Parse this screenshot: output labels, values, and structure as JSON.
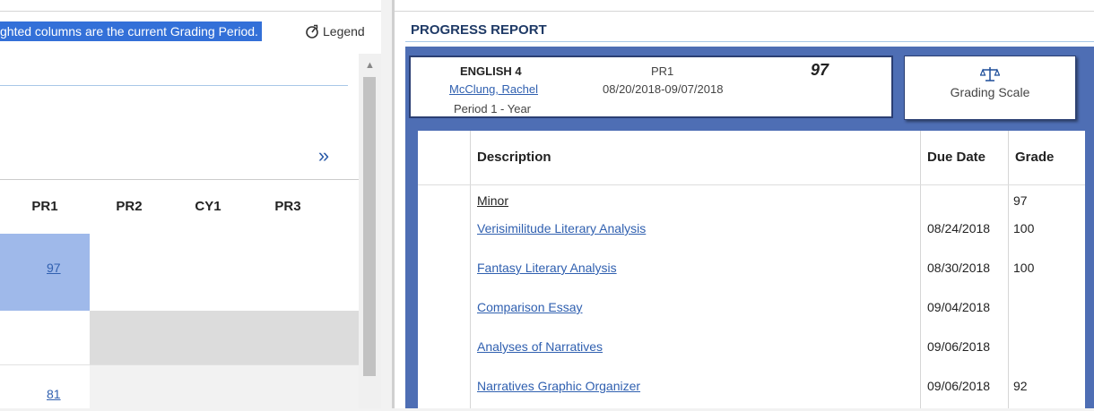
{
  "left": {
    "highlight_note": "ghted columns are the current Grading Period.",
    "legend_label": "Legend",
    "next_arrow": "»",
    "columns": [
      "PR1",
      "PR2",
      "CY1",
      "PR3"
    ],
    "rows": [
      {
        "PR1": "97"
      },
      {
        "PR1": ""
      },
      {
        "PR1": "81"
      }
    ],
    "scroll_up": "▲",
    "colors": {
      "highlight": "#3370d8",
      "current_period_cell": "#9fb9ea",
      "disabled_row": "#dcdcdc"
    }
  },
  "progress_report": {
    "title": "PROGRESS REPORT",
    "course": {
      "name": "ENGLISH 4",
      "teacher": "McClung, Rachel",
      "period": "Period 1 - Year",
      "term": "PR1",
      "date_range": "08/20/2018-09/07/2018",
      "grade": "97"
    },
    "grading_scale_label": "Grading Scale",
    "table_headers": {
      "description": "Description",
      "due_date": "Due Date",
      "grade": "Grade"
    },
    "assignments": [
      {
        "description": "Minor",
        "due_date": "",
        "grade": "97"
      },
      {
        "description": "Verisimilitude Literary Analysis",
        "due_date": "08/24/2018",
        "grade": "100"
      },
      {
        "description": "Fantasy Literary Analysis",
        "due_date": "08/30/2018",
        "grade": "100"
      },
      {
        "description": "Comparison Essay",
        "due_date": "09/04/2018",
        "grade": ""
      },
      {
        "description": "Analyses of Narratives",
        "due_date": "09/06/2018",
        "grade": ""
      },
      {
        "description": "Narratives Graphic Organizer",
        "due_date": "09/06/2018",
        "grade": "92"
      }
    ],
    "colors": {
      "frame": "#4e6eb4",
      "title": "#1f3a66",
      "link": "#3060b0"
    }
  }
}
